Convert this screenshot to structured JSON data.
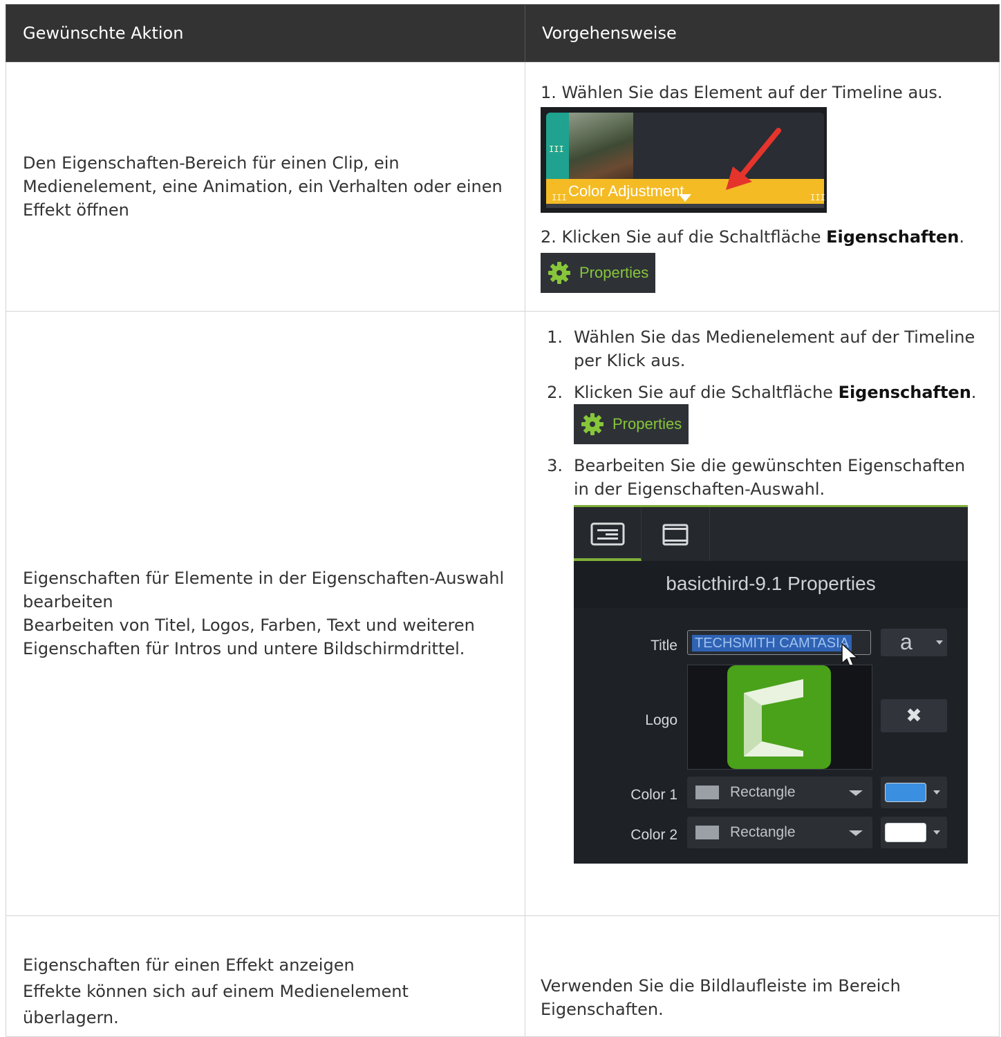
{
  "table": {
    "headers": [
      "Gewünschte Aktion",
      "Vorgehensweise"
    ],
    "row1": {
      "action": "Den Eigenschaften-Bereich für einen Clip, ein Medienelement, eine Animation, ein Verhalten oder einen Effekt öffnen",
      "step1": "1. Wählen Sie das Element auf der Timeline aus.",
      "step2_prefix": "2. Klicken Sie auf die Schaltfläche ",
      "step2_bold": "Eigenschaften",
      "step2_suffix": "."
    },
    "row2": {
      "action_line1": "Eigenschaften für Elemente in der Eigenschaften-Auswahl bearbeiten",
      "action_line2": "Bearbeiten von Titel, Logos, Farben, Text und weiteren Eigenschaften für Intros und untere Bildschirmdrittel.",
      "steps": [
        {
          "num": "1.",
          "text": "Wählen Sie das Medienelement auf der Timeline per Klick aus."
        },
        {
          "num": "2.",
          "prefix": "Klicken Sie auf die Schaltfläche ",
          "bold": "Eigenschaften",
          "suffix": "."
        },
        {
          "num": "3.",
          "text": "Bearbeiten Sie die gewünschten Eigenschaften in der Eigenschaften-Auswahl."
        }
      ]
    },
    "row3": {
      "action_line1": "Eigenschaften für einen Effekt anzeigen",
      "action_line2": "Effekte können sich auf einem Medienelement überlagern.",
      "how": "Verwenden Sie die Bildlaufleiste im Bereich Eigenschaften."
    }
  },
  "timeline_clip": {
    "label": "Color Adjustment",
    "bar_color": "#f4bb24",
    "handle_color": "#1fa28f",
    "grip": "III"
  },
  "properties_button": {
    "label": "Properties",
    "icon": "gear-icon",
    "accent": "#87c63a"
  },
  "properties_panel": {
    "tabs": [
      "properties-tab-icon",
      "film-tab-icon"
    ],
    "title": "basicthird-9.1 Properties",
    "title_label": "Title",
    "title_value": "TECHSMITH CAMTASIA",
    "font_glyph": "a",
    "logo_label": "Logo",
    "remove_glyph": "✖",
    "color1_label": "Color 1",
    "color2_label": "Color 2",
    "shape1": "Rectangle",
    "shape2": "Rectangle",
    "color1": "#3b8fe0",
    "color2": "#ffffff"
  }
}
